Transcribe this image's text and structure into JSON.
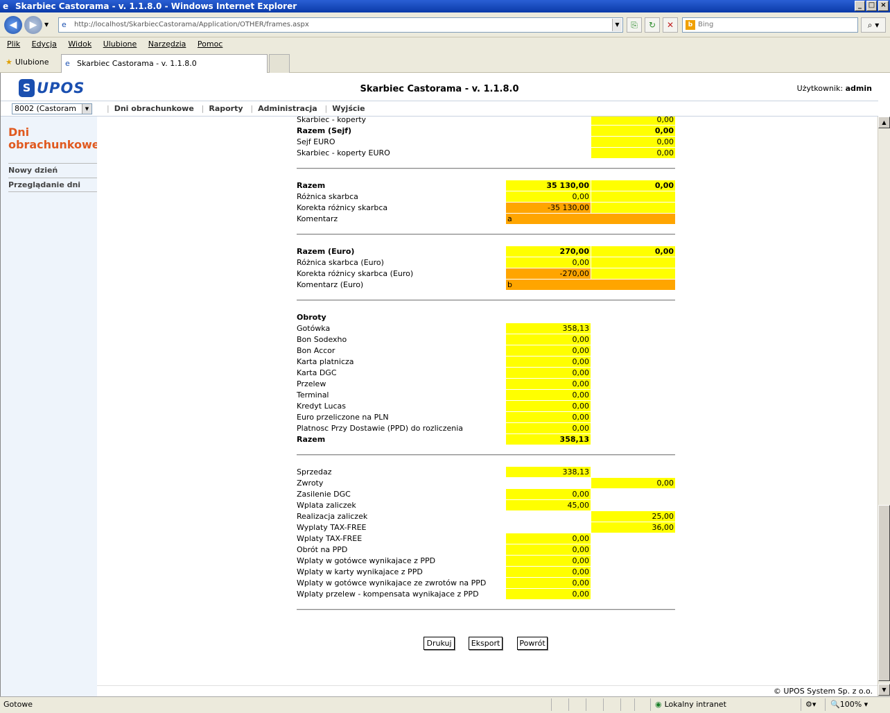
{
  "browser": {
    "window_title": "Skarbiec Castorama - v. 1.1.8.0 - Windows Internet Explorer",
    "address": "http://localhost/SkarbiecCastorama/Application/OTHER/frames.aspx",
    "search_placeholder": "Bing",
    "menu": [
      "Plik",
      "Edycja",
      "Widok",
      "Ulubione",
      "Narzędzia",
      "Pomoc"
    ],
    "favorites_label": "Ulubione",
    "tab_title": "Skarbiec Castorama - v. 1.1.8.0",
    "status_text": "Gotowe",
    "zone": "Lokalny intranet",
    "zoom": "100%"
  },
  "app": {
    "logo": "UPOS",
    "title": "Skarbiec Castorama - v. 1.1.8.0",
    "user_label": "Użytkownik:",
    "user_name": "admin",
    "store_select": "8002 (Castoram",
    "nav": [
      "Dni obrachunkowe",
      "Raporty",
      "Administracja",
      "Wyjście"
    ],
    "footer": "© UPOS System Sp. z o.o."
  },
  "sidebar": {
    "title_line1": "Dni",
    "title_line2": "obrachunkowe",
    "items": [
      "Nowy dzień",
      "Przeglądanie dni"
    ]
  },
  "report": {
    "sejf": [
      {
        "label": "Skarbiec - koperty",
        "c2": "0,00"
      },
      {
        "label": "Razem (Sejf)",
        "c2": "0,00",
        "bold": true
      },
      {
        "label": "Sejf EURO",
        "c2": "0,00"
      },
      {
        "label": "Skarbiec - koperty EURO",
        "c2": "0,00"
      }
    ],
    "razem": {
      "label": "Razem",
      "c1": "35 130,00",
      "c2": "0,00",
      "roznica_label": "Różnica skarbca",
      "roznica": "0,00",
      "korekta_label": "Korekta różnicy skarbca",
      "korekta": "-35 130,00",
      "komentarz_label": "Komentarz",
      "komentarz": "a"
    },
    "razem_euro": {
      "label": "Razem (Euro)",
      "c1": "270,00",
      "c2": "0,00",
      "roznica_label": "Różnica skarbca (Euro)",
      "roznica": "0,00",
      "korekta_label": "Korekta różnicy skarbca (Euro)",
      "korekta": "-270,00",
      "komentarz_label": "Komentarz (Euro)",
      "komentarz": "b"
    },
    "obroty_title": "Obroty",
    "obroty": [
      {
        "label": "Gotówka",
        "c1": "358,13"
      },
      {
        "label": "Bon Sodexho",
        "c1": "0,00"
      },
      {
        "label": "Bon Accor",
        "c1": "0,00"
      },
      {
        "label": "Karta platnicza",
        "c1": "0,00"
      },
      {
        "label": "Karta DGC",
        "c1": "0,00"
      },
      {
        "label": "Przelew",
        "c1": "0,00"
      },
      {
        "label": "Terminal",
        "c1": "0,00"
      },
      {
        "label": "Kredyt Lucas",
        "c1": "0,00"
      },
      {
        "label": "Euro przeliczone na PLN",
        "c1": "0,00"
      },
      {
        "label": "Platnosc Przy Dostawie (PPD) do rozliczenia",
        "c1": "0,00"
      },
      {
        "label": "Razem",
        "c1": "358,13",
        "bold": true
      }
    ],
    "sprzedaz": [
      {
        "label": "Sprzedaz",
        "c1": "338,13"
      },
      {
        "label": "Zwroty",
        "c2": "0,00"
      },
      {
        "label": "Zasilenie DGC",
        "c1": "0,00"
      },
      {
        "label": "Wplata zaliczek",
        "c1": "45,00"
      },
      {
        "label": "Realizacja zaliczek",
        "c2": "25,00"
      },
      {
        "label": "Wyplaty TAX-FREE",
        "c2": "36,00"
      },
      {
        "label": "Wplaty TAX-FREE",
        "c1": "0,00"
      },
      {
        "label": "Obrót na PPD",
        "c1": "0,00"
      },
      {
        "label": "Wplaty w gotówce wynikajace z PPD",
        "c1": "0,00"
      },
      {
        "label": "Wplaty w karty wynikajace z PPD",
        "c1": "0,00"
      },
      {
        "label": "Wplaty w gotówce wynikajace ze zwrotów na PPD",
        "c1": "0,00"
      },
      {
        "label": "Wplaty przelew - kompensata wynikajace z PPD",
        "c1": "0,00"
      }
    ],
    "buttons": {
      "print": "Drukuj",
      "export": "Eksport",
      "back": "Powrót"
    }
  }
}
